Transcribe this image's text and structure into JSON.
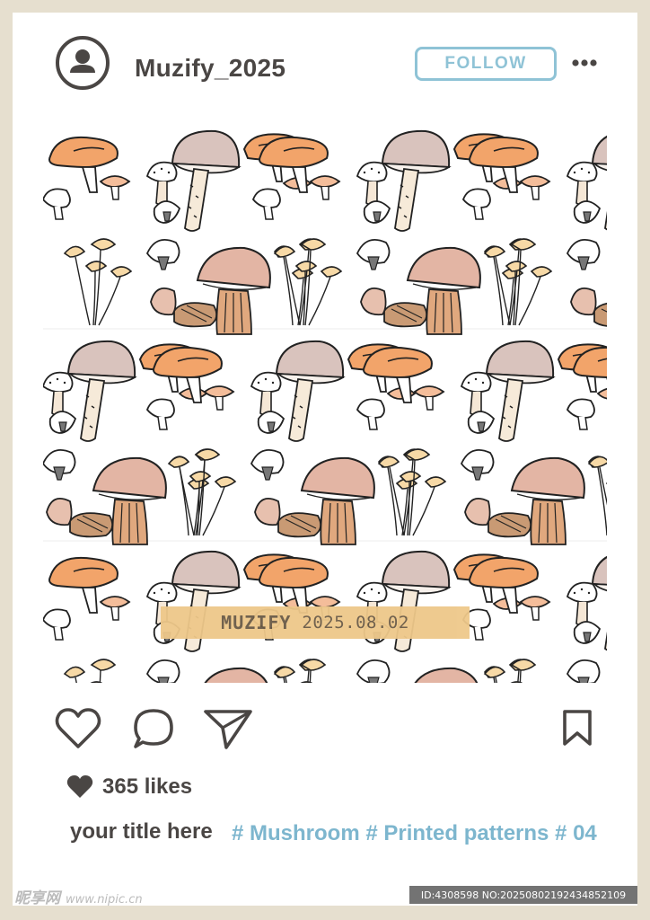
{
  "header": {
    "username": "Muzify_2025",
    "follow_label": "FOLLOW"
  },
  "icons": {
    "avatar": "user-icon",
    "more": "more-horizontal-icon",
    "like": "heart-outline-icon",
    "comment": "comment-bubble-icon",
    "share": "paper-plane-icon",
    "save": "bookmark-icon",
    "likes": "heart-filled-icon"
  },
  "photo": {
    "stamp_brand": "MUZIFY",
    "stamp_date": "2025.08.02"
  },
  "footer": {
    "likes_text": "365 likes",
    "caption_title": "your title here",
    "hashtags": "# Mushroom # Printed patterns # 04"
  },
  "watermark": {
    "site_name": "昵享网",
    "site_url": "www.nipic.cn",
    "image_id": "ID:4308598 NO:20250802192434852109"
  },
  "colors": {
    "frame": "#e6dfcf",
    "text": "#4a4644",
    "accent": "#8fc3d6",
    "stamp": "#eec88a"
  }
}
